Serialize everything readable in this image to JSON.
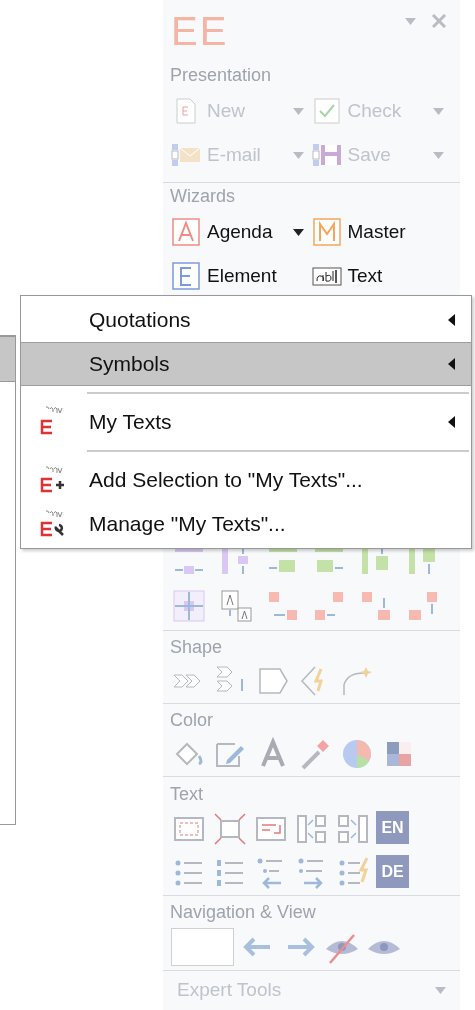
{
  "panel": {
    "logo": "EE",
    "sections": [
      {
        "title": "Presentation",
        "items": [
          {
            "label": "New",
            "disabled": true,
            "dropdown": true
          },
          {
            "label": "Check",
            "disabled": true,
            "dropdown": true
          },
          {
            "label": "E-mail",
            "disabled": true,
            "dropdown": true
          },
          {
            "label": "Save",
            "disabled": true,
            "dropdown": true
          }
        ]
      },
      {
        "title": "Wizards",
        "items": [
          {
            "label": "Agenda",
            "disabled": false,
            "dropdown": true
          },
          {
            "label": "Master",
            "disabled": false,
            "dropdown": false
          },
          {
            "label": "Element",
            "disabled": false,
            "dropdown": false
          },
          {
            "label": "Text",
            "disabled": false,
            "dropdown": false
          }
        ]
      }
    ],
    "shape_title": "Shape",
    "color_title": "Color",
    "text_title": "Text",
    "language_buttons": [
      "EN",
      "DE"
    ],
    "navigation_title": "Navigation & View",
    "expert_tools": {
      "label": "Expert Tools",
      "expanded": false
    }
  },
  "parent_menu": {
    "highlighted_row": {
      "selected": true
    }
  },
  "context_menu": {
    "items": [
      {
        "kind": "submenu",
        "label": "Quotations",
        "selected": false
      },
      {
        "kind": "submenu",
        "label": "Symbols",
        "selected": true
      },
      {
        "kind": "separator"
      },
      {
        "kind": "submenu",
        "label": "My Texts",
        "selected": false
      },
      {
        "kind": "separator"
      },
      {
        "kind": "command",
        "label": "Add Selection to \"My Texts\"...",
        "selected": false
      },
      {
        "kind": "command",
        "label": "Manage \"My Texts\"...",
        "selected": false
      }
    ]
  }
}
